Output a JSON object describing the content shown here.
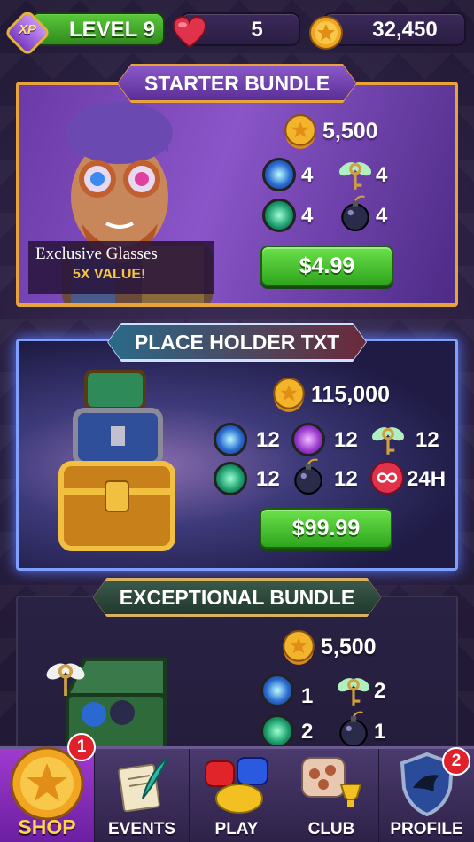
{
  "topbar": {
    "xp_badge": "XP",
    "level": "LEVEL 9",
    "lives": "5",
    "coins": "32,450"
  },
  "starter_bundle": {
    "title": "STARTER BUNDLE",
    "glasses_label": "Exclusive Glasses",
    "value_label": "5X VALUE!",
    "coins": "5,500",
    "items": [
      {
        "icon": "blue-orb-icon",
        "qty": "4"
      },
      {
        "icon": "winged-key-icon",
        "qty": "4"
      },
      {
        "icon": "green-bolt-icon",
        "qty": "4"
      },
      {
        "icon": "bomb-icon",
        "qty": "4"
      }
    ],
    "price": "$4.99"
  },
  "place_bundle": {
    "title": "PLACE HOLDER TXT",
    "coins": "115,000",
    "items": [
      {
        "icon": "blue-orb-icon",
        "qty": "12"
      },
      {
        "icon": "purple-orb-icon",
        "qty": "12"
      },
      {
        "icon": "winged-key-icon",
        "qty": "12"
      },
      {
        "icon": "green-bolt-icon",
        "qty": "12"
      },
      {
        "icon": "bomb-icon",
        "qty": "12"
      },
      {
        "icon": "infinite-heart-icon",
        "qty": "24H"
      }
    ],
    "price": "$99.99"
  },
  "exceptional_bundle": {
    "title": "EXCEPTIONAL BUNDLE",
    "coins": "5,500",
    "items": [
      {
        "icon": "blue-orb-icon",
        "qty": "1"
      },
      {
        "icon": "winged-key-icon",
        "qty": "2"
      },
      {
        "icon": "green-bolt-icon",
        "qty": "2"
      },
      {
        "icon": "bomb-icon",
        "qty": "1"
      }
    ]
  },
  "nav": {
    "shop": "SHOP",
    "shop_badge": "1",
    "events": "EVENTS",
    "play": "PLAY",
    "club": "CLUB",
    "profile": "PROFILE",
    "profile_badge": "2"
  },
  "colors": {
    "gold_border": "#e8a33a",
    "buy_green": "#3fb82a",
    "badge_red": "#e0202a",
    "place_border": "#7fa0ff"
  }
}
